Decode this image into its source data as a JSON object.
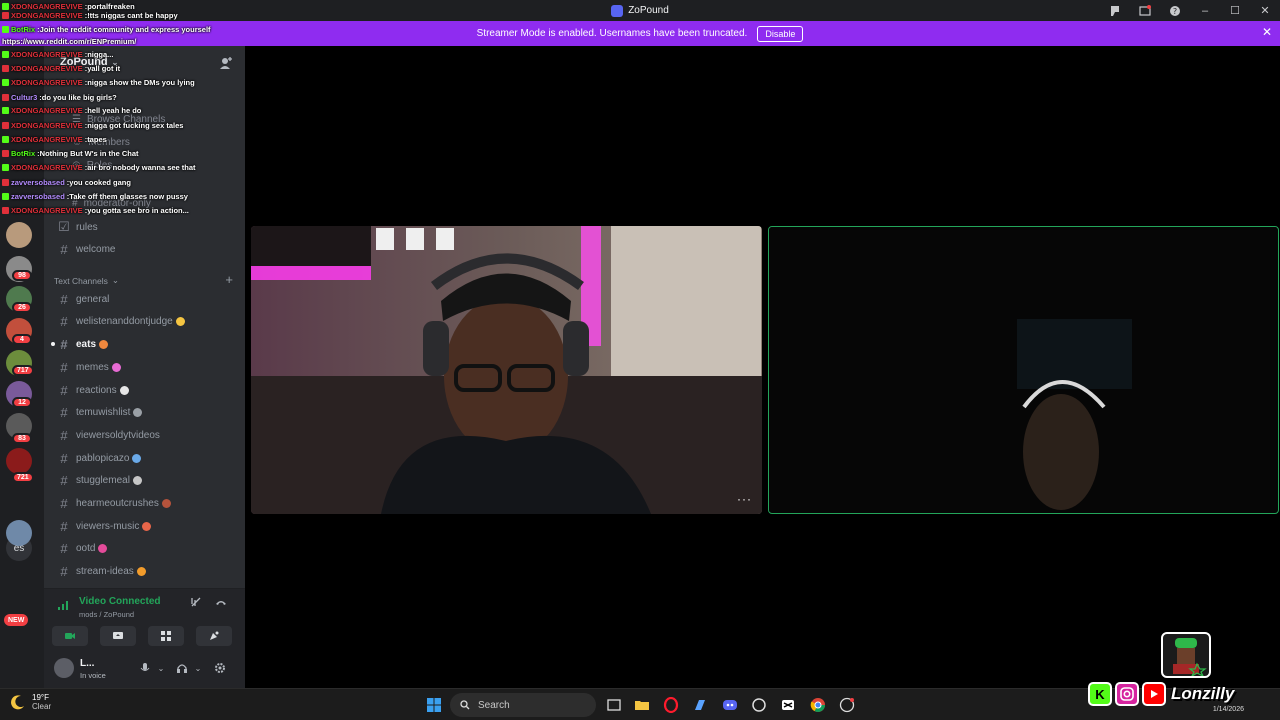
{
  "window": {
    "title": "ZoPound"
  },
  "banner": {
    "message": "Streamer Mode is enabled. Usernames have been truncated.",
    "button": "Disable"
  },
  "rail": {
    "badges": [
      "98",
      "26",
      "4",
      "717",
      "12",
      "83",
      "721"
    ],
    "text_server": "es",
    "new_label": "NEW"
  },
  "server": {
    "name": "ZoPound",
    "browse_channels": "Browse Channels",
    "members": "Members",
    "roles": "Roles",
    "moderator_only": "moderator-only"
  },
  "channels_top": [
    {
      "name": "rules",
      "icon": "rules-icon"
    },
    {
      "name": "welcome",
      "icon": "hash-icon"
    }
  ],
  "category": {
    "label": "Text Channels"
  },
  "channels": [
    {
      "name": "general"
    },
    {
      "name": "welistenanddontjudge"
    },
    {
      "name": "eats",
      "active": true
    },
    {
      "name": "memes"
    },
    {
      "name": "reactions"
    },
    {
      "name": "temuwishlist"
    },
    {
      "name": "viewersoldytvideos"
    },
    {
      "name": "pablopicazo"
    },
    {
      "name": "stugglemeal"
    },
    {
      "name": "hearmeoutcrushes"
    },
    {
      "name": "viewers-music"
    },
    {
      "name": "ootd"
    },
    {
      "name": "stream-ideas"
    }
  ],
  "voice": {
    "status": "Video Connected",
    "location": "mods / ZoPound"
  },
  "user": {
    "name": "L...",
    "status": "In voice"
  },
  "chat": [
    {
      "user": "XDONGANGREVIVE",
      "color": "#e0303a",
      "text": "portalfreaken"
    },
    {
      "user": "XDONGANGREVIVE",
      "color": "#e0303a",
      "text": "!tts niggas cant be happy"
    },
    {
      "user": "BotRix",
      "color": "#53fc18",
      "text": "Join the reddit community and express yourself"
    },
    {
      "user": "",
      "color": "#ffffff",
      "text": "https://www.reddit.com/r/ENPremium/"
    },
    {
      "user": "XDONGANGREVIVE",
      "color": "#e0303a",
      "text": "nigga..."
    },
    {
      "user": "XDONGANGREVIVE",
      "color": "#e0303a",
      "text": "yall got it"
    },
    {
      "user": "XDONGANGREVIVE",
      "color": "#e0303a",
      "text": "nigga show the DMs you lying"
    },
    {
      "user": "Cultur3",
      "color": "#b48cff",
      "text": "do you like big girls?"
    },
    {
      "user": "XDONGANGREVIVE",
      "color": "#e0303a",
      "text": "hell yeah he do"
    },
    {
      "user": "XDONGANGREVIVE",
      "color": "#e0303a",
      "text": "nigga got fucking sex tales"
    },
    {
      "user": "XDONGANGREVIVE",
      "color": "#e0303a",
      "text": "tapes"
    },
    {
      "user": "BotRix",
      "color": "#53fc18",
      "text": "Nothing But W's in the Chat"
    },
    {
      "user": "XDONGANGREVIVE",
      "color": "#e0303a",
      "text": "air bro nobody wanna see that"
    },
    {
      "user": "zavversobased",
      "color": "#b48cff",
      "text": "you cooked gang"
    },
    {
      "user": "zavversobased",
      "color": "#b48cff",
      "text": "Take off them glasses now pussy"
    },
    {
      "user": "XDONGANGREVIVE",
      "color": "#e0303a",
      "text": "you gotta see bro in action..."
    }
  ],
  "taskbar": {
    "temperature": "19°F",
    "condition": "Clear",
    "search_placeholder": "Search",
    "date": "1/14/2026"
  },
  "overlay": {
    "handle": "Lonzilly",
    "kick_letter": "K"
  },
  "colors": {
    "accent": "#5865f2",
    "banner": "#8f2cf0",
    "connected": "#23a55a",
    "danger": "#f23f43"
  }
}
